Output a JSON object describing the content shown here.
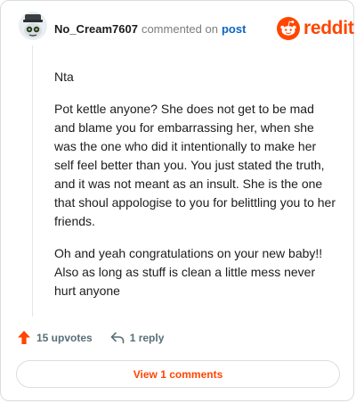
{
  "comment": {
    "username": "No_Cream7607",
    "action_text": "commented on",
    "post_link": "post",
    "paragraphs": [
      "Nta",
      "Pot kettle anyone? She does not get to be mad and blame you for embarrassing her, when she was the one who did it intentionally to make her self feel better than you. You just stated the truth, and it was not meant as an insult. She is the one that shoul appologise to you for belittling you to her friends.",
      "Oh and yeah congratulations on your new baby!! Also as long as stuff is clean a little mess never hurt anyone"
    ]
  },
  "brand": {
    "name": "reddit",
    "icon": "reddit-alien-icon",
    "color": "#ff4500"
  },
  "actions": {
    "upvotes_label": "15 upvotes",
    "upvote_icon": "upvote-arrow-icon",
    "reply_label": "1 reply",
    "reply_icon": "reply-arrow-icon"
  },
  "view_comments_label": "View 1 comments",
  "colors": {
    "accent": "#ff4500",
    "link": "#0a66c2",
    "muted": "#576f76"
  }
}
